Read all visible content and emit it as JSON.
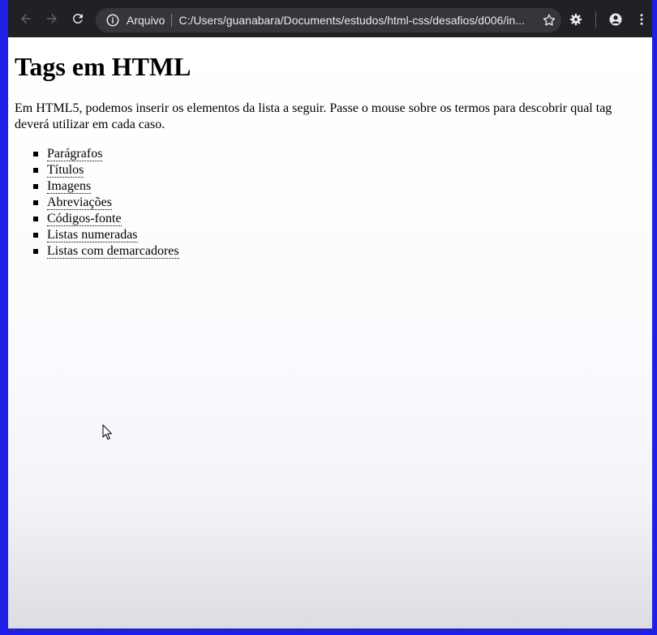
{
  "browser": {
    "omnibox": {
      "security_label": "Arquivo",
      "url": "C:/Users/guanabara/Documents/estudos/html-css/desafios/d006/in..."
    },
    "icons": [
      "back-arrow-icon",
      "forward-arrow-icon",
      "reload-icon",
      "info-icon",
      "star-icon",
      "extension-gear-icon",
      "account-icon",
      "menu-dots-icon"
    ]
  },
  "page": {
    "title": "Tags em HTML",
    "intro": "Em HTML5, podemos inserir os elementos da lista a seguir. Passe o mouse sobre os termos para descobrir qual tag deverá utilizar em cada caso.",
    "items": [
      "Parágrafos",
      "Títulos",
      "Imagens",
      "Abreviações",
      "Códigos-fonte",
      "Listas numeradas",
      "Listas com demarcadores"
    ]
  }
}
